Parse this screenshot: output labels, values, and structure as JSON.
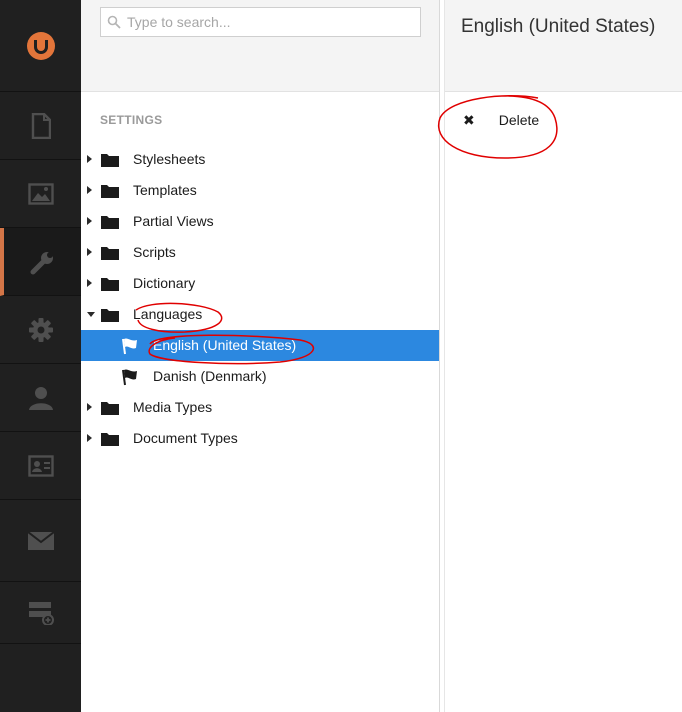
{
  "rail": {
    "items": [
      {
        "name": "logo",
        "icon": "umbraco-logo-icon"
      },
      {
        "name": "content",
        "icon": "document-icon"
      },
      {
        "name": "media",
        "icon": "image-icon"
      },
      {
        "name": "settings",
        "icon": "wrench-icon",
        "active": true
      },
      {
        "name": "developer",
        "icon": "gear-icon"
      },
      {
        "name": "users",
        "icon": "user-icon"
      },
      {
        "name": "members",
        "icon": "id-card-icon"
      },
      {
        "name": "forms",
        "icon": "envelope-icon"
      },
      {
        "name": "bottom",
        "icon": "add-section-icon"
      }
    ],
    "accent": "#d37547"
  },
  "search": {
    "placeholder": "Type to search..."
  },
  "tree": {
    "section_title": "SETTINGS",
    "nodes": [
      {
        "label": "Stylesheets"
      },
      {
        "label": "Templates"
      },
      {
        "label": "Partial Views"
      },
      {
        "label": "Scripts"
      },
      {
        "label": "Dictionary"
      },
      {
        "label": "Languages",
        "expanded": true
      },
      {
        "label": "English (United States)",
        "selected": true
      },
      {
        "label": "Danish (Denmark)"
      },
      {
        "label": "Media Types"
      },
      {
        "label": "Document Types"
      }
    ],
    "selected_color": "#2c88e0"
  },
  "main": {
    "title": "English (United States)",
    "actions": [
      {
        "label": "Delete",
        "icon": "x-icon"
      }
    ]
  }
}
